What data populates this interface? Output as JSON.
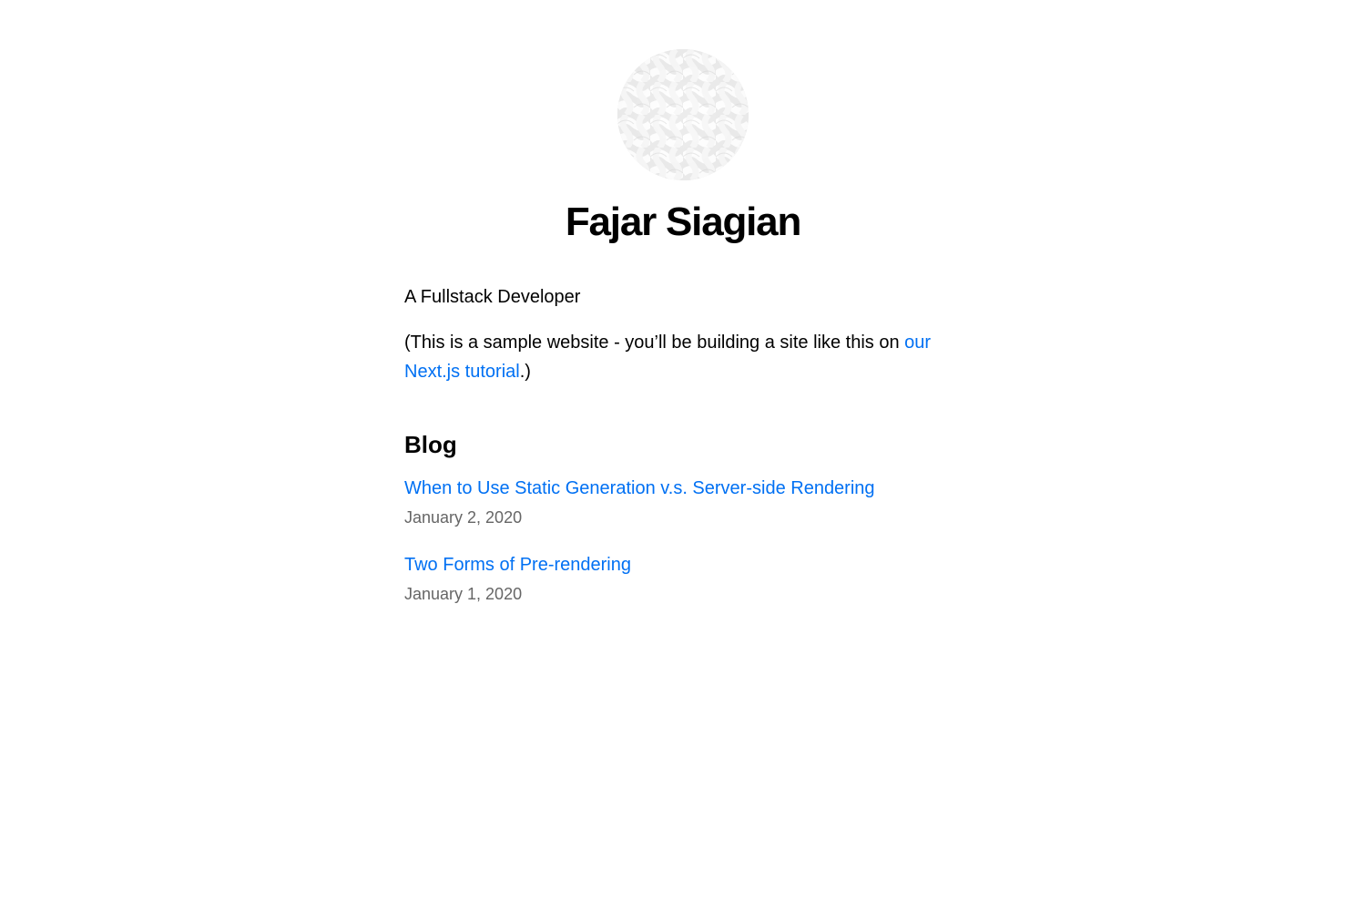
{
  "profile": {
    "name": "Fajar Siagian",
    "avatar_icon": "woven-pattern-avatar"
  },
  "intro": {
    "text": "A Fullstack Developer"
  },
  "note": {
    "prefix": "(This is a sample website - you’ll be building a site like this on ",
    "link_text": "our Next.js tutorial",
    "suffix": ".)"
  },
  "blog": {
    "heading": "Blog",
    "posts": [
      {
        "title": "When to Use Static Generation v.s. Server-side Rendering",
        "date": "January 2, 2020"
      },
      {
        "title": "Two Forms of Pre-rendering",
        "date": "January 1, 2020"
      }
    ]
  },
  "colors": {
    "link": "#0070f3",
    "muted": "#666666",
    "text": "#000000"
  }
}
